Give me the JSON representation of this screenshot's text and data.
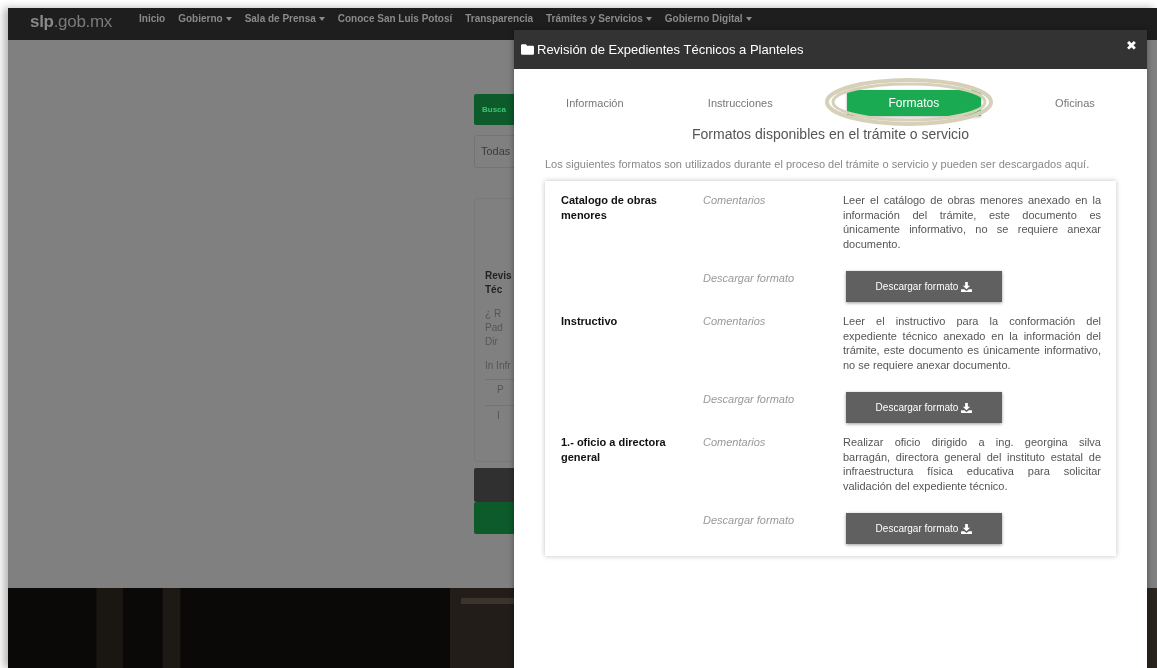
{
  "navbar": {
    "logo": {
      "a": "slp",
      "b": ".gob.mx"
    },
    "items": [
      {
        "label": "Inicio",
        "dropdown": false
      },
      {
        "label": "Gobierno",
        "dropdown": true
      },
      {
        "label": "Sala de Prensa",
        "dropdown": true
      },
      {
        "label": "Conoce San Luis Potosí",
        "dropdown": false
      },
      {
        "label": "Transparencia",
        "dropdown": false
      },
      {
        "label": "Trámites y Servicios",
        "dropdown": true
      },
      {
        "label": "Gobierno Digital",
        "dropdown": true
      }
    ]
  },
  "background": {
    "search_button": "Busca",
    "select": "Todas",
    "card_title": [
      "Revis",
      "Téc"
    ],
    "card_lines": [
      "¿",
      "R",
      "Pad",
      "Dir"
    ],
    "card_lines_2": [
      "In",
      "Infr"
    ],
    "card_rows": [
      "P",
      "I"
    ]
  },
  "modal": {
    "title": "Revisión de Expedientes Técnicos a Planteles",
    "close": "✖",
    "tabs": [
      {
        "label": "Información",
        "selected": false
      },
      {
        "label": "Instrucciones",
        "selected": false
      },
      {
        "label": "Formatos",
        "selected": true
      },
      {
        "label": "Oficinas",
        "selected": false
      }
    ],
    "heading": "Formatos disponibles en el trámite o servicio",
    "intro": "Los siguientes formatos son utilizados durante el proceso del trámite o servicio y pueden ser descargados aquí.",
    "formats": [
      {
        "name": "Catalogo de obras menores",
        "comments_label": "Comentarios",
        "comments": "Leer el catálogo de obras menores anexado en la información del trámite, este documento es únicamente informativo, no se requiere anexar documento.",
        "download_label": "Descargar formato",
        "download_button": "Descargar formato"
      },
      {
        "name": "Instructivo",
        "comments_label": "Comentarios",
        "comments": "Leer el instructivo para la conformación del expediente técnico anexado en la información del trámite, este documento es únicamente informativo, no se requiere anexar documento.",
        "download_label": "Descargar formato",
        "download_button": "Descargar formato"
      },
      {
        "name": "1.- oficio a directora general",
        "comments_label": "Comentarios",
        "comments": "Realizar oficio dirigido a ing. georgina silva barragán, directora general del instituto estatal de infraestructura física educativa para solicitar validación del expediente técnico.",
        "download_label": "Descargar formato",
        "download_button": "Descargar formato"
      }
    ]
  }
}
